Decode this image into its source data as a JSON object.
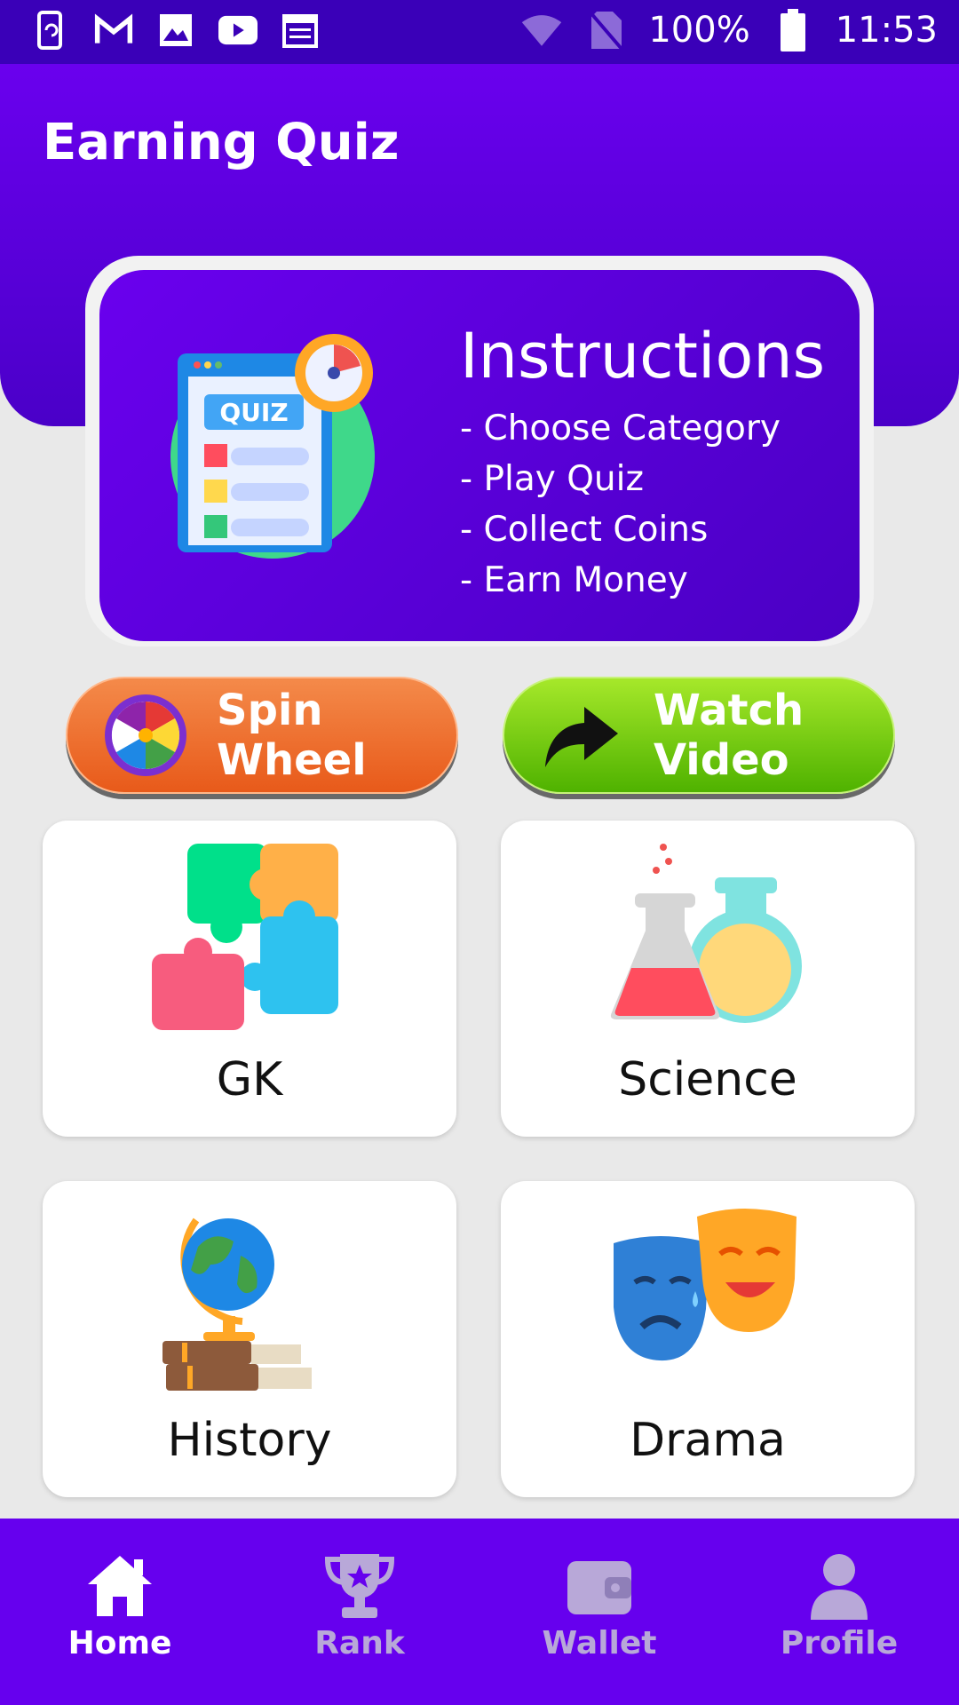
{
  "status_bar": {
    "battery": "100%",
    "time": "11:53"
  },
  "app": {
    "title": "Earning Quiz"
  },
  "instructions": {
    "title": "Instructions",
    "steps": [
      "- Choose Category",
      "- Play Quiz",
      "- Collect Coins",
      "- Earn Money"
    ],
    "badge_text": "QUIZ"
  },
  "actions": {
    "spin_label": "Spin Wheel",
    "watch_label": "Watch Video"
  },
  "categories": [
    {
      "label": "GK",
      "icon": "puzzle-icon"
    },
    {
      "label": "Science",
      "icon": "flask-icon"
    },
    {
      "label": "History",
      "icon": "globe-books-icon"
    },
    {
      "label": "Drama",
      "icon": "theater-masks-icon"
    }
  ],
  "nav": {
    "items": [
      {
        "label": "Home",
        "icon": "home-icon",
        "active": true
      },
      {
        "label": "Rank",
        "icon": "trophy-icon",
        "active": false
      },
      {
        "label": "Wallet",
        "icon": "wallet-icon",
        "active": false
      },
      {
        "label": "Profile",
        "icon": "profile-icon",
        "active": false
      }
    ]
  },
  "colors": {
    "primary": "#6600ee",
    "status_bar": "#3a00b8",
    "spin": "#e85a1a",
    "watch": "#4fb200",
    "nav_inactive": "#b8a8d8"
  }
}
